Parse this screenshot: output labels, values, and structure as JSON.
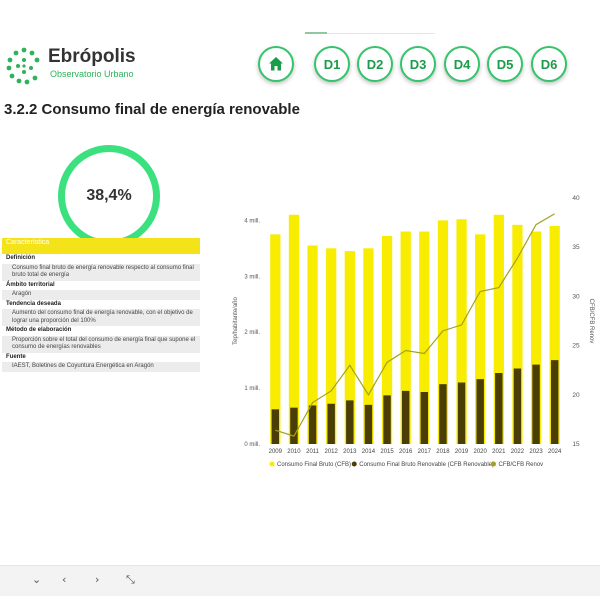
{
  "brand": {
    "name": "Ebrópolis",
    "subtitle": "Observatorio Urbano"
  },
  "nav": {
    "home_icon": "home-icon",
    "buttons": [
      "D1",
      "D2",
      "D3",
      "D4",
      "D5",
      "D6"
    ]
  },
  "page_title": "3.2.2 Consumo final de energía renovable",
  "kpi": {
    "value": "38,4%",
    "ring_color": "#3be07f"
  },
  "info_table": {
    "header": "Característica",
    "rows": [
      {
        "label": "Definición",
        "value": "Consumo final bruto de energía renovable respecto al consumo final bruto total de energía"
      },
      {
        "label": "Ámbito territorial",
        "value": "Aragón"
      },
      {
        "label": "Tendencia deseada",
        "value": "Aumento del consumo final de energía renovable, con el objetivo de lograr una proporción del 100%"
      },
      {
        "label": "Método de elaboración",
        "value": "Proporción sobre el total del consumo de energía final que supone el consumo de energías renovables"
      },
      {
        "label": "Fuente",
        "value": "IAEST, Boletines de Coyuntura Energética en Aragón"
      }
    ]
  },
  "chart_data": {
    "type": "bar",
    "categories": [
      "2009",
      "2010",
      "2011",
      "2012",
      "2013",
      "2014",
      "2015",
      "2016",
      "2017",
      "2018",
      "2019",
      "2020",
      "2021",
      "2022",
      "2023",
      "2024"
    ],
    "series": [
      {
        "name": "Consumo Final Bruto (CFB)",
        "type": "bar",
        "color": "#f8ec00",
        "values": [
          3.75,
          4.1,
          3.55,
          3.5,
          3.45,
          3.5,
          3.72,
          3.8,
          3.8,
          4.0,
          4.02,
          3.75,
          4.1,
          3.92,
          3.8,
          3.9
        ]
      },
      {
        "name": "Consumo Final Bruto Renovable (CFB Renovable)",
        "type": "bar",
        "color": "#4a3e06",
        "values": [
          0.62,
          0.65,
          0.69,
          0.72,
          0.78,
          0.7,
          0.87,
          0.95,
          0.93,
          1.07,
          1.1,
          1.16,
          1.27,
          1.35,
          1.42,
          1.5
        ]
      },
      {
        "name": "CFB/CFB Renov",
        "type": "line",
        "axis": "right",
        "color": "#a2a21c",
        "values": [
          16.4,
          15.8,
          19.2,
          20.4,
          23.0,
          20.0,
          23.3,
          24.5,
          24.2,
          26.5,
          27.1,
          30.5,
          30.9,
          33.9,
          37.3,
          38.4
        ]
      }
    ],
    "ylabel": "Tep/habitante/año",
    "ylabel_right": "CFB/CFB Renov",
    "ylim": [
      0,
      4.4
    ],
    "ylim_right": [
      15,
      40
    ],
    "yticks": [
      {
        "v": 0,
        "label": "0 mill."
      },
      {
        "v": 1,
        "label": "1 mill."
      },
      {
        "v": 2,
        "label": "2 mill."
      },
      {
        "v": 3,
        "label": "3 mill."
      },
      {
        "v": 4,
        "label": "4 mill."
      }
    ],
    "yticks_right": [
      15,
      20,
      25,
      30,
      35,
      40
    ],
    "grid": false,
    "legend_position": "bottom"
  },
  "footer": {
    "icons": [
      "chevron-down-icon",
      "prev-page-icon",
      "next-page-icon",
      "collapse-icon"
    ],
    "glyphs": [
      "⌄",
      "‹",
      "›",
      "⤡"
    ]
  }
}
